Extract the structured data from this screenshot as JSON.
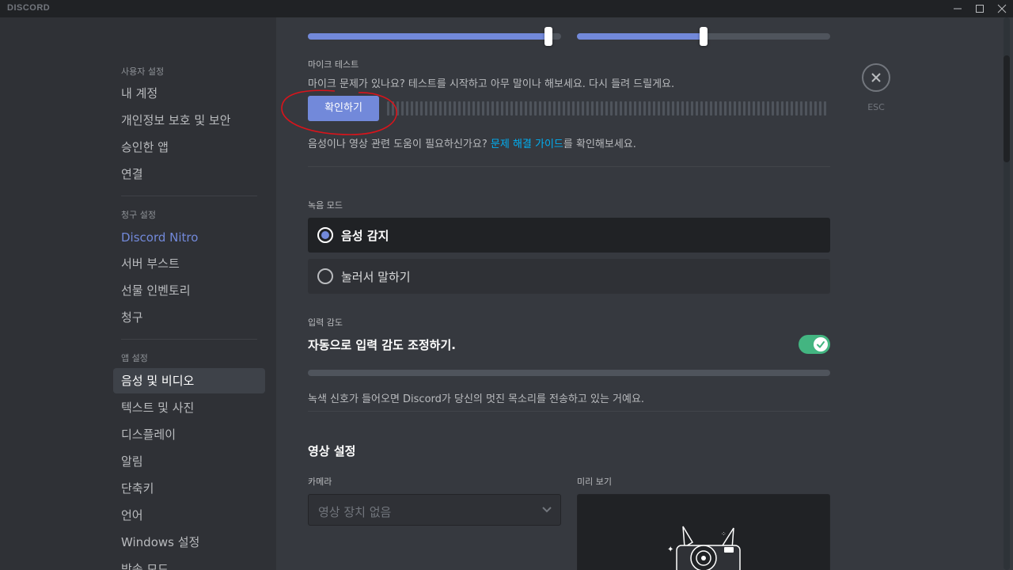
{
  "app": {
    "title": "DISCORD"
  },
  "sidebar": {
    "user_settings_header": "사용자 설정",
    "user_items": [
      "내 계정",
      "개인정보 보호 및 보안",
      "승인한 앱",
      "연결"
    ],
    "billing_header": "청구 설정",
    "billing_items": [
      "Discord Nitro",
      "서버 부스트",
      "선물 인벤토리",
      "청구"
    ],
    "app_header": "앱 설정",
    "app_items": [
      "음성 및 비디오",
      "텍스트 및 사진",
      "디스플레이",
      "알림",
      "단축키",
      "언어",
      "Windows 설정",
      "방송 모드"
    ],
    "selected": "음성 및 비디오"
  },
  "sliders": {
    "input_volume_fraction": 0.95,
    "output_volume_fraction": 0.5
  },
  "mic_test": {
    "label": "마이크 테스트",
    "description": "마이크 문제가 있나요? 테스트를 시작하고 아무 말이나 해보세요. 다시 들려 드릴게요.",
    "button": "확인하기",
    "help_prefix": "음성이나 영상 관련 도움이 필요하신가요? ",
    "help_link": "문제 해결 가이드",
    "help_suffix": "를 확인해보세요."
  },
  "input_mode": {
    "label": "녹음 모드",
    "options": [
      "음성 감지",
      "눌러서 말하기"
    ],
    "selected": "음성 감지"
  },
  "sensitivity": {
    "label": "입력 감도",
    "auto_label": "자동으로 입력 감도 조정하기.",
    "auto_enabled": true,
    "note": "녹색 신호가 들어오면 Discord가 당신의 멋진 목소리를 전송하고 있는 거예요."
  },
  "video": {
    "title": "영상 설정",
    "camera_label": "카메라",
    "camera_value": "영상 장치 없음",
    "preview_label": "미리 보기"
  },
  "esc": {
    "label": "ESC"
  },
  "colors": {
    "accent": "#7289da",
    "link": "#00b0f4",
    "toggle_on": "#43b581",
    "annotation": "#d9141b"
  }
}
